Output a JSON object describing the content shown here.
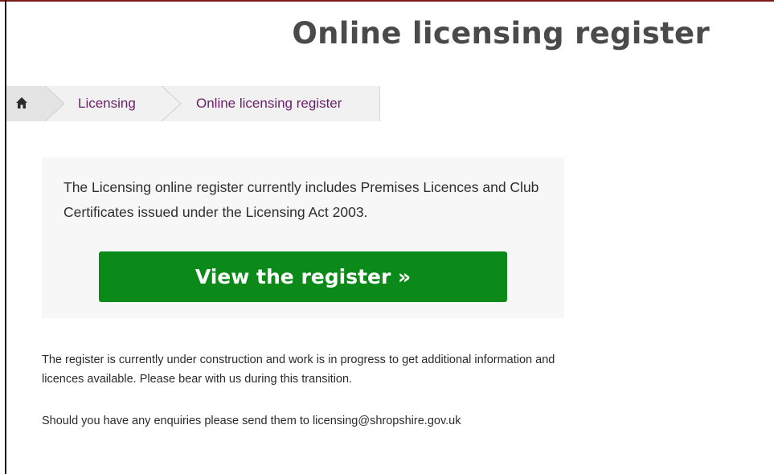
{
  "header": {
    "title": "Online licensing register"
  },
  "breadcrumb": {
    "home_icon": "home-icon",
    "items": [
      {
        "label": "Licensing"
      },
      {
        "label": "Online licensing register"
      }
    ]
  },
  "info_box": {
    "text": "The Licensing online register currently includes Premises Licences and Club Certificates issued under the Licensing Act 2003.",
    "button_label": "View the register »"
  },
  "notes": {
    "construction": "The register is currently under construction and work is in progress to get additional information and licences available. Please bear with us during this transition.",
    "enquiries": "Should you have any enquiries please send them to licensing@shropshire.gov.uk"
  },
  "colors": {
    "button_green": "#0b8a1a",
    "breadcrumb_link": "#6b1f6b",
    "title_grey": "#4a4a4a",
    "panel_bg": "#f7f7f7"
  }
}
